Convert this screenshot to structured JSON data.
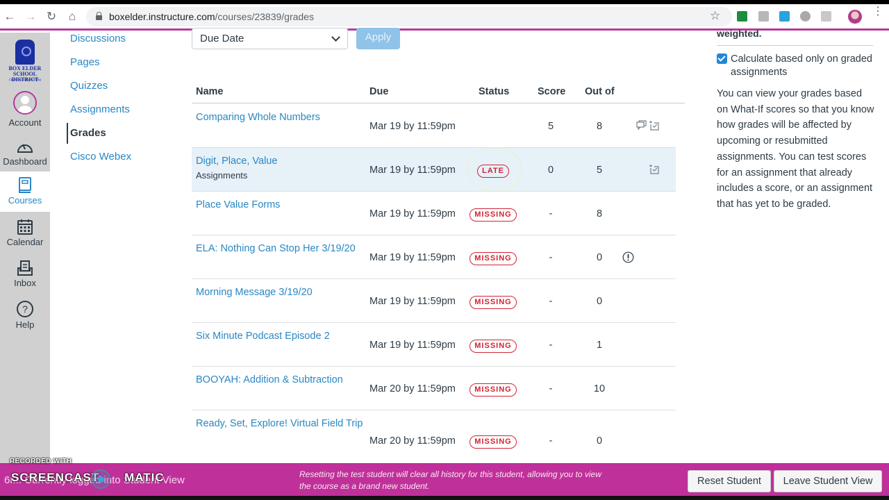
{
  "browser": {
    "url_host": "boxelder.instructure.com",
    "url_path": "/courses/23839/grades",
    "back_icon": "arrow-left",
    "forward_icon": "arrow-right",
    "reload_icon": "reload",
    "home_icon": "home",
    "bookmark_icon": "star",
    "extensions": [
      {
        "name": "google-classroom",
        "color": "#1e8e3e"
      },
      {
        "name": "puzzle-extension",
        "color": "#b0b0b0"
      },
      {
        "name": "cloud-extension",
        "color": "#2aa3dd"
      },
      {
        "name": "gray-extension",
        "color": "#a9a9a9"
      },
      {
        "name": "w-extension",
        "color": "#c8c8c8"
      }
    ]
  },
  "global_nav": {
    "logo": {
      "line1": "BOX ELDER",
      "line2": "SCHOOL DISTRICT",
      "tagline": "Learning is Everything"
    },
    "items": [
      {
        "label": "Account",
        "icon": "user-avatar"
      },
      {
        "label": "Dashboard",
        "icon": "speedometer"
      },
      {
        "label": "Courses",
        "icon": "book",
        "active": true
      },
      {
        "label": "Calendar",
        "icon": "calendar"
      },
      {
        "label": "Inbox",
        "icon": "inbox"
      },
      {
        "label": "Help",
        "icon": "question-circle"
      }
    ]
  },
  "course_nav": {
    "items": [
      {
        "label": "Discussions"
      },
      {
        "label": "Pages"
      },
      {
        "label": "Quizzes"
      },
      {
        "label": "Assignments"
      },
      {
        "label": "Grades",
        "active": true
      },
      {
        "label": "Cisco Webex"
      }
    ]
  },
  "filters": {
    "sort_selected": "Due Date",
    "apply_label": "Apply"
  },
  "table": {
    "headers": {
      "name": "Name",
      "due": "Due",
      "status": "Status",
      "score": "Score",
      "out_of": "Out of"
    },
    "rows": [
      {
        "name": "Comparing Whole Numbers",
        "sub": "",
        "due": "Mar 19 by 11:59pm",
        "status": "",
        "score": "5",
        "out_of": "8",
        "icons": [
          "comments",
          "rubric"
        ]
      },
      {
        "name": "Digit, Place, Value",
        "sub": "Assignments",
        "due": "Mar 19 by 11:59pm",
        "status": "LATE",
        "score": "0",
        "out_of": "5",
        "icons": [
          "rubric"
        ]
      },
      {
        "name": "Place Value Forms",
        "sub": "",
        "due": "Mar 19 by 11:59pm",
        "status": "MISSING",
        "score": "-",
        "out_of": "8",
        "icons": []
      },
      {
        "name": "ELA: Nothing Can Stop Her 3/19/20",
        "sub": "",
        "due": "Mar 19 by 11:59pm",
        "status": "MISSING",
        "score": "-",
        "out_of": "0",
        "icons": [
          "warning"
        ]
      },
      {
        "name": "Morning Message 3/19/20",
        "sub": "",
        "due": "Mar 19 by 11:59pm",
        "status": "MISSING",
        "score": "-",
        "out_of": "0",
        "icons": []
      },
      {
        "name": "Six Minute Podcast Episode 2",
        "sub": "",
        "due": "Mar 19 by 11:59pm",
        "status": "MISSING",
        "score": "-",
        "out_of": "1",
        "icons": []
      },
      {
        "name": "BOOYAH: Addition & Subtraction",
        "sub": "",
        "due": "Mar 20 by 11:59pm",
        "status": "MISSING",
        "score": "-",
        "out_of": "10",
        "icons": []
      },
      {
        "name": "Ready, Set, Explore! Virtual Field Trip",
        "sub": "",
        "due": "Mar 20 by 11:59pm",
        "status": "MISSING",
        "score": "-",
        "out_of": "0",
        "icons": []
      }
    ]
  },
  "sidebar": {
    "weighted_text": "weighted.",
    "checkbox_label": "Calculate based only on graded assignments",
    "checkbox_checked": true,
    "whatif_text": "You can view your grades based on What-If scores so that you know how grades will be affected by upcoming or resubmitted assignments. You can test scores for an assignment that already includes a score, or an assignment that has yet to be graded."
  },
  "student_view": {
    "title": "6r... Currently logged into Student View",
    "message": "Resetting the test student will clear all history for this student, allowing you to view the course as a brand new student.",
    "reset_label": "Reset Student",
    "leave_label": "Leave Student View"
  },
  "watermark": {
    "line1": "RECORDED WITH",
    "line2": "SCREENCAST",
    "line3": "MATIC"
  },
  "colors": {
    "accent_link": "#2987c4",
    "status_red": "#d22232",
    "student_view_bar": "#c0309a",
    "text": "#2d3b45"
  }
}
